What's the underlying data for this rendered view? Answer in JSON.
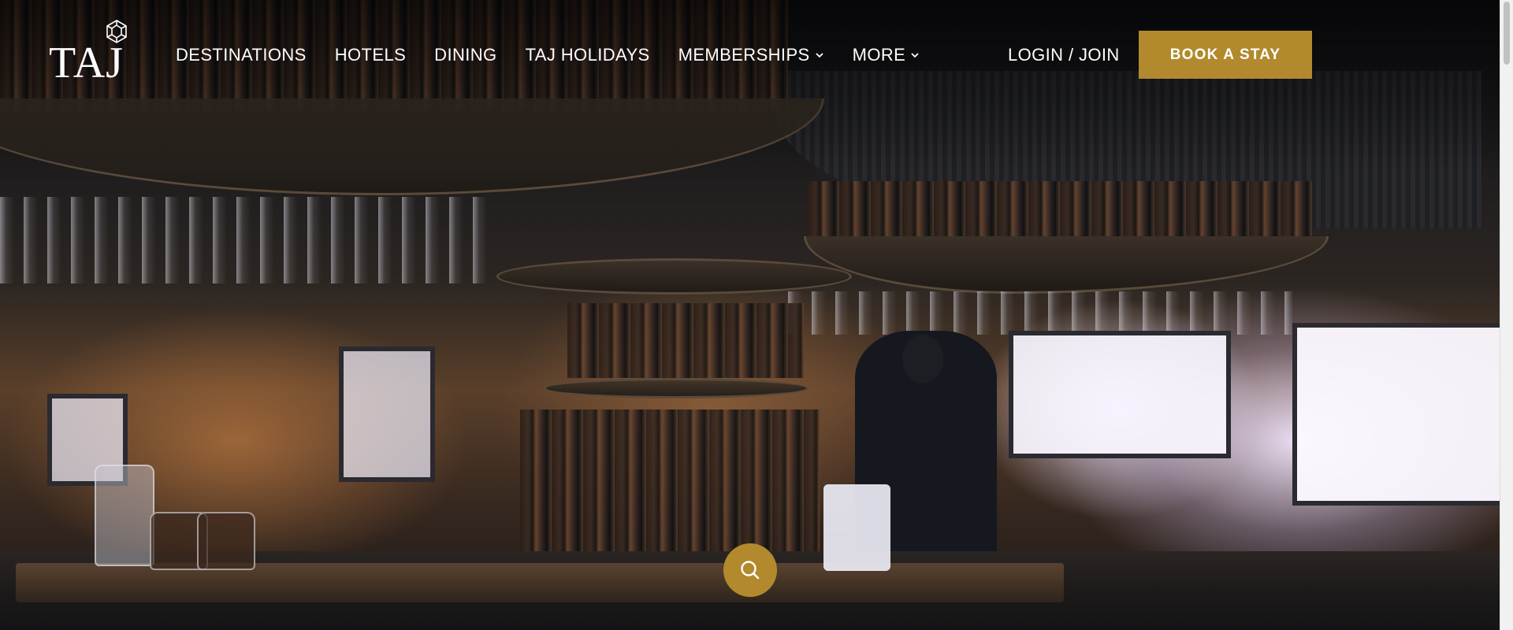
{
  "brand": {
    "logo_text": "TAJ",
    "logo_emblem_icon": "taj-emblem-icon"
  },
  "nav": {
    "items": [
      {
        "label": "DESTINATIONS",
        "has_dropdown": false
      },
      {
        "label": "HOTELS",
        "has_dropdown": false
      },
      {
        "label": "DINING",
        "has_dropdown": false
      },
      {
        "label": "TAJ HOLIDAYS",
        "has_dropdown": false
      },
      {
        "label": "MEMBERSHIPS",
        "has_dropdown": true
      },
      {
        "label": "MORE",
        "has_dropdown": true
      }
    ],
    "login_label": "LOGIN / JOIN",
    "book_label": "BOOK A STAY"
  },
  "hero": {
    "image_icon": "bar-interior-photo",
    "search_icon": "search-icon"
  },
  "colors": {
    "accent_gold": "#b28a2d",
    "text_white": "#ffffff"
  }
}
